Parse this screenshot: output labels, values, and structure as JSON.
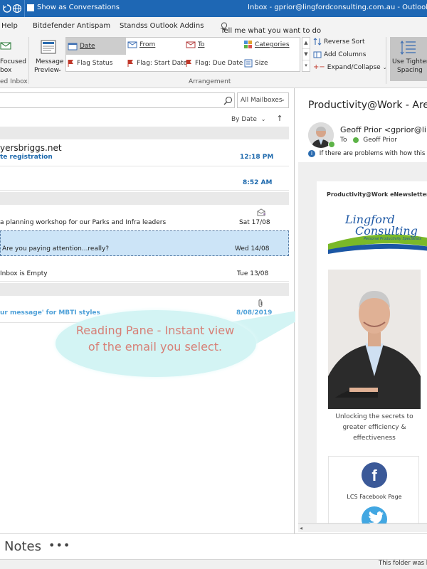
{
  "titlebar": {
    "show_as_conversations": "Show as Conversations",
    "window_title": "Inbox - gprior@lingfordconsulting.com.au  -  Outlook"
  },
  "tabs": [
    "Help",
    "Bitdefender Antispam",
    "Standss Outlook Addins",
    "Tell me what you want to do"
  ],
  "ribbon": {
    "focused_inbox_label_1": "Focused",
    "focused_inbox_label_2": "box",
    "focused_group_label": "ed Inbox",
    "message_preview_1": "Message",
    "message_preview_2": "Preview",
    "arrangement_items": [
      "Date",
      "From",
      "To",
      "Categories",
      "Flag Status",
      "Flag: Start Date",
      "Flag: Due Date",
      "Size"
    ],
    "selected_arrangement": "Date",
    "reverse_sort": "Reverse Sort",
    "add_columns": "Add Columns",
    "expand_collapse": "Expand/Collapse",
    "group_label": "Arrangement",
    "tighter_spacing_1": "Use Tighter",
    "tighter_spacing_2": "Spacing"
  },
  "mail_list": {
    "search_scope": "All Mailboxes",
    "sort_label": "By Date",
    "items": [
      {
        "from": "yersbriggs.net",
        "subject": "te registration",
        "date": "12:18 PM"
      },
      {
        "from": "",
        "subject": "",
        "date": "8:52 AM"
      },
      {
        "from": "",
        "subject": "a planning workshop for our Parks and Infra leaders",
        "date": "Sat 17/08"
      },
      {
        "from": "",
        "subject": "Are you paying attention...really?",
        "date": "Wed 14/08"
      },
      {
        "from": "",
        "subject": "Inbox is Empty",
        "date": "Tue 13/08"
      },
      {
        "from": "",
        "subject": "ur message' for MBTI styles",
        "date": "8/08/2019"
      }
    ]
  },
  "callout": {
    "line1": "Reading Pane - Instant view",
    "line2": "of the email you select."
  },
  "reading_pane": {
    "subject": "Productivity@Work - Are",
    "sender": "Geoff Prior <gprior@ling",
    "to_label": "To",
    "to_name": "Geoff Prior",
    "info_bar": "If there are problems with how this me",
    "newsletter_title": "Productivity@Work eNewsletter",
    "logo_line1": "Lingford",
    "logo_line2": "Consulting",
    "logo_tagline": "Personal Productivity Specialists",
    "tagline": "Unlocking the secrets to greater efficiency & effectiveness",
    "facebook_label": "LCS Facebook Page"
  },
  "bottom": {
    "notes": "Notes",
    "more": "•••",
    "status": "This folder was la"
  },
  "colors": {
    "titlebar": "#1e67b4",
    "unread_blue": "#1d69ad",
    "selected_row": "#cce4f7",
    "callout_fill": "#d3f4f4",
    "callout_text": "#d77f76",
    "facebook": "#3b5998",
    "twitter": "#42a7e2",
    "logo_blue": "#1c57a4",
    "logo_green": "#7ab929"
  }
}
